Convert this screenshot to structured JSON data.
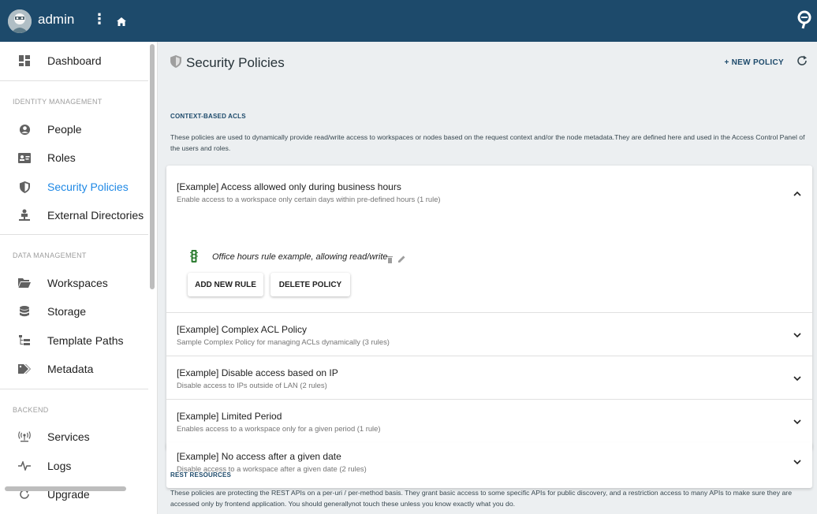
{
  "topbar": {
    "username": "admin",
    "more_icon": "⋮",
    "home_icon": "home-icon",
    "brand_icon": "brand-logo-icon",
    "colors": {
      "bar": "#1d4a6b",
      "text": "#ffffff"
    }
  },
  "sidebar": {
    "dashboard": "Dashboard",
    "sections": {
      "identity": "IDENTITY MANAGEMENT",
      "data": "DATA MANAGEMENT",
      "backend": "BACKEND"
    },
    "items": {
      "people": "People",
      "roles": "Roles",
      "security_policies": "Security Policies",
      "external_directories": "External Directories",
      "workspaces": "Workspaces",
      "storage": "Storage",
      "template_paths": "Template Paths",
      "metadata": "Metadata",
      "services": "Services",
      "logs": "Logs",
      "upgrade": "Upgrade"
    },
    "active_item": "Security Policies",
    "active_color": "#1e88e5"
  },
  "page": {
    "title": "Security Policies",
    "new_policy_label": "+ NEW POLICY",
    "refresh_icon": "refresh-icon"
  },
  "acl_section": {
    "title": "CONTEXT-BASED ACLS",
    "description": "These policies are used to dynamically provide read/write access to workspaces or nodes based on the request context and/or the node metadata.They are defined here and used in the Access Control Panel of the users and roles.",
    "policies": [
      {
        "name": "[Example] Access allowed only during business hours",
        "desc": "Enable access to a workspace only certain days within pre-defined hours (1 rule)",
        "expanded": true,
        "rules": [
          "Office hours rule example, allowing read/write"
        ],
        "buttons": {
          "add_rule": "ADD NEW RULE",
          "delete_policy": "DELETE POLICY"
        }
      },
      {
        "name": "[Example] Complex ACL Policy",
        "desc": "Sample Complex Policy for managing ACLs dynamically (3 rules)",
        "expanded": false
      },
      {
        "name": "[Example] Disable access based on IP",
        "desc": "Disable access to IPs outside of LAN (2 rules)",
        "expanded": false
      },
      {
        "name": "[Example] Limited Period",
        "desc": "Enables access to a workspace only for a given period (1 rule)",
        "expanded": false
      },
      {
        "name": "[Example] No access after a given date",
        "desc": "Disable access to a workspace after a given date (2 rules)",
        "expanded": false
      }
    ]
  },
  "rest_section": {
    "title": "REST RESOURCES",
    "description": "These policies are protecting the REST APIs on a per-uri / per-method basis. They grant basic access to some specific APIs for public discovery, and a restriction access to many APIs to make sure they are accessed only by frontend application. You should generallynot touch these unless you know exactly what you do."
  }
}
